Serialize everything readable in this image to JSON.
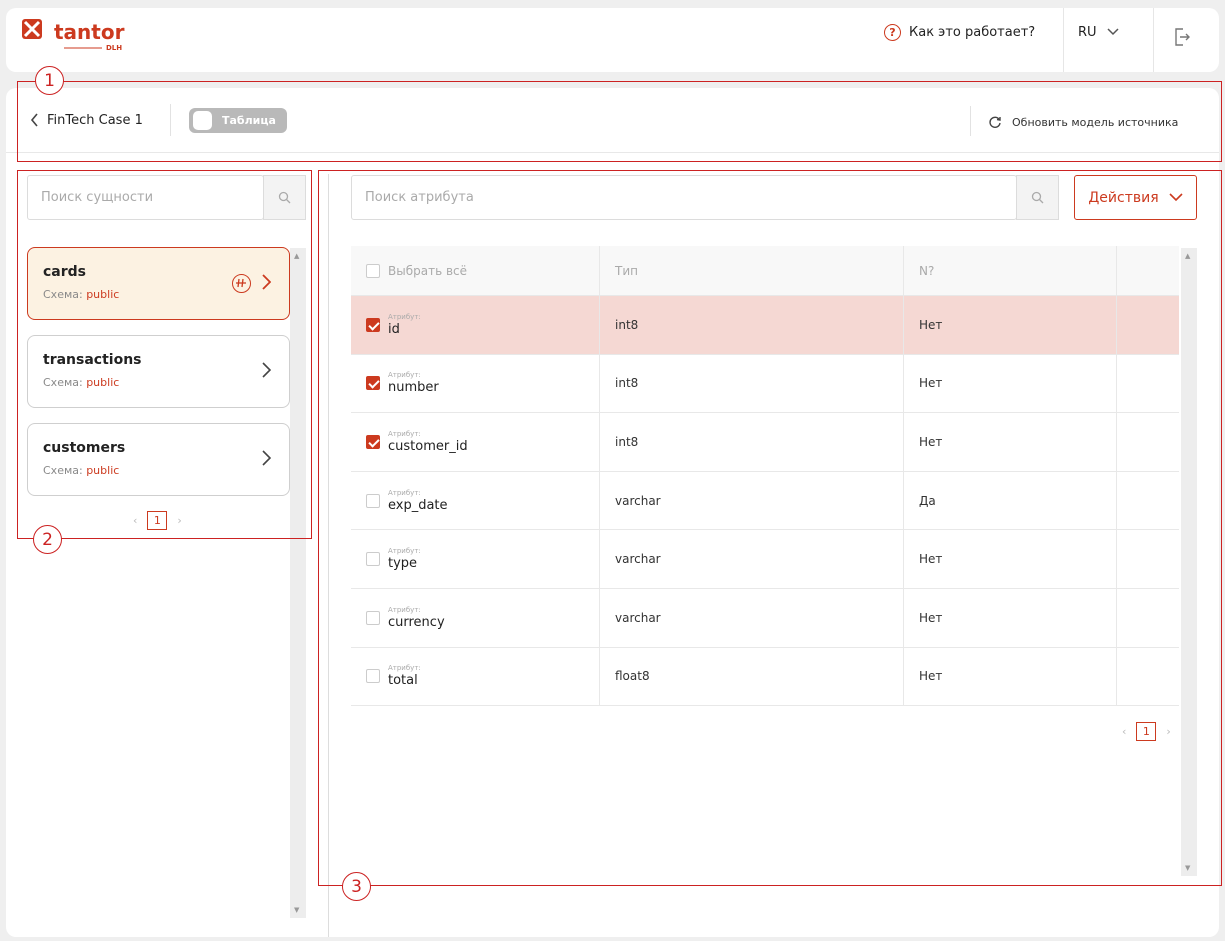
{
  "header": {
    "logo_text": "tantor",
    "logo_sub": "DLH",
    "help_label": "Как это работает?",
    "lang": "RU"
  },
  "toolbar": {
    "back_label": "FinTech Case 1",
    "toggle_label": "Таблица",
    "refresh_label": "Обновить модель источника"
  },
  "left": {
    "search_placeholder": "Поиск сущности",
    "schema_label": "Схема:",
    "entities": [
      {
        "name": "cards",
        "schema": "public"
      },
      {
        "name": "transactions",
        "schema": "public"
      },
      {
        "name": "customers",
        "schema": "public"
      }
    ],
    "page": "1"
  },
  "right": {
    "search_placeholder": "Поиск атрибута",
    "actions_label": "Действия",
    "columns": {
      "select_all": "Выбрать всё",
      "type": "Тип",
      "nullable": "N?"
    },
    "attr_label": "Атрибут:",
    "rows": [
      {
        "name": "id",
        "type": "int8",
        "nullable": "Нет",
        "checked": true
      },
      {
        "name": "number",
        "type": "int8",
        "nullable": "Нет",
        "checked": true
      },
      {
        "name": "customer_id",
        "type": "int8",
        "nullable": "Нет",
        "checked": true
      },
      {
        "name": "exp_date",
        "type": "varchar",
        "nullable": "Да",
        "checked": false
      },
      {
        "name": "type",
        "type": "varchar",
        "nullable": "Нет",
        "checked": false
      },
      {
        "name": "currency",
        "type": "varchar",
        "nullable": "Нет",
        "checked": false
      },
      {
        "name": "total",
        "type": "float8",
        "nullable": "Нет",
        "checked": false
      }
    ],
    "page": "1"
  },
  "annotations": [
    "1",
    "2",
    "3"
  ],
  "colors": {
    "accent": "#cc3a1f",
    "selected_row": "#f5d8d3",
    "active_card": "#fcf2e2",
    "annotation": "#cc2222"
  }
}
